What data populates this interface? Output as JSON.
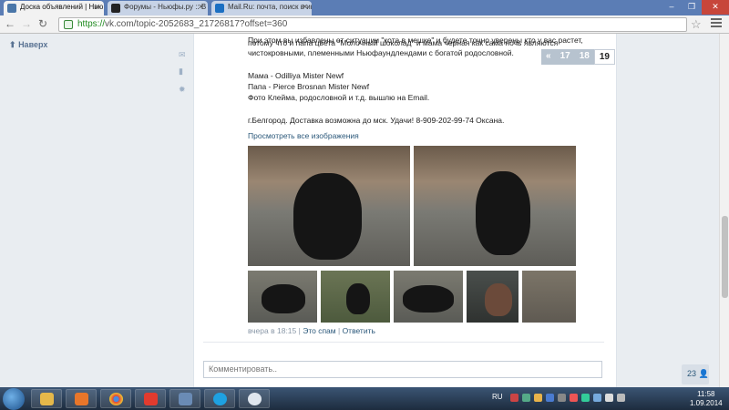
{
  "tabs": [
    {
      "label": "Доска объявлений | Нью",
      "active": true,
      "favicon_color": "#4a76a8"
    },
    {
      "label": "Форумы - Ньюфы.ру :: В",
      "active": false,
      "favicon_color": "#222222"
    },
    {
      "label": "Mail.Ru: почта, поиск в ин",
      "active": false,
      "favicon_color": "#1b6fc2"
    }
  ],
  "url": {
    "https": "https://",
    "rest": "vk.com/topic-2052683_21726817?offset=360"
  },
  "sidebar": {
    "up_label": "Наверх"
  },
  "post": {
    "line1": "При этом вы избавлены от ситуации \"кота в мешке\" и будете точно уверены кто у вас растет,",
    "line2": "потому что и папа цвета \"Молочный шоколад\" и мама черная как сама ночь являются",
    "line3": "чистокровными, племенными Ньюфаундлендами с богатой родословной.",
    "mom": "Мама - Odilliya Mister Newf",
    "dad": "Папа - Pierce Brosnan Mister Newf",
    "photo_note": "Фото Клейма, родословной и т.д. вышлю на Email.",
    "city": "г.Белгород. Доставка возможна до мск. Удачи! 8-909-202-99-74 Оксана.",
    "view_all": "Просмотреть все изображения",
    "time": "вчера в 18:15",
    "spam": "Это спам",
    "reply": "Ответить"
  },
  "pager": {
    "prev": "«",
    "p1": "17",
    "p2": "18",
    "current": "19"
  },
  "comment": {
    "placeholder": "Комментировать.."
  },
  "chat": {
    "count": "23"
  },
  "taskbar": {
    "lang": "RU",
    "time": "11:58",
    "date": "1.09.2014"
  }
}
